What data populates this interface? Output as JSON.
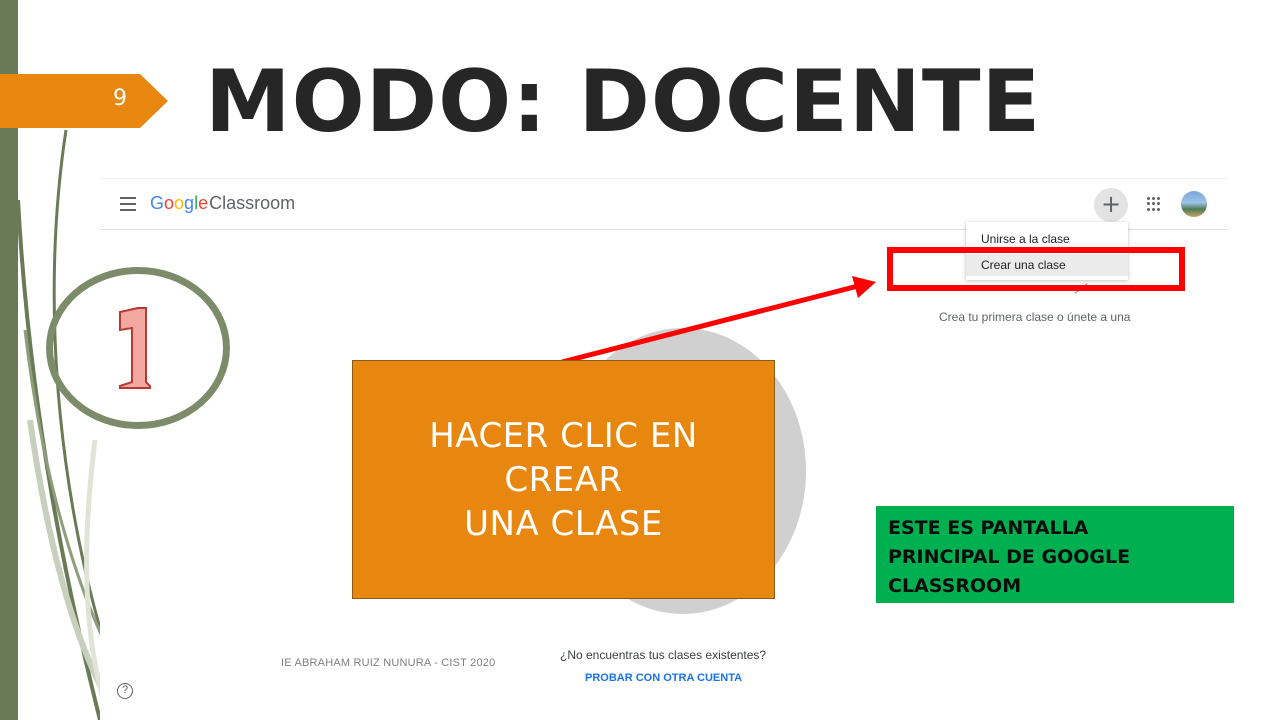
{
  "slide": {
    "number": "9",
    "title": "MODO: DOCENTE",
    "footer": "IE ABRAHAM RUIZ NUNURA - CIST 2020",
    "step_number": "1",
    "accent_color": "#e8870f",
    "highlight_color": "#ff0000"
  },
  "classroom": {
    "logo_google": [
      "G",
      "o",
      "o",
      "g",
      "l",
      "e"
    ],
    "logo_product": "Classroom",
    "plus_label": "+",
    "menu_items": [
      {
        "label": "Unirse a la clase"
      },
      {
        "label": "Crear una clase"
      }
    ],
    "empty_state": "Crea tu primera clase o únete a una",
    "not_found": "¿No encuentras tus clases existentes?",
    "try_account": "PROBAR CON OTRA CUENTA",
    "help_label": "?"
  },
  "callouts": {
    "instruction": "HACER CLIC EN\nCREAR\nUNA CLASE",
    "note": "ESTE ES PANTALLA\nPRINCIPAL DE GOOGLE\nCLASSROOM"
  }
}
